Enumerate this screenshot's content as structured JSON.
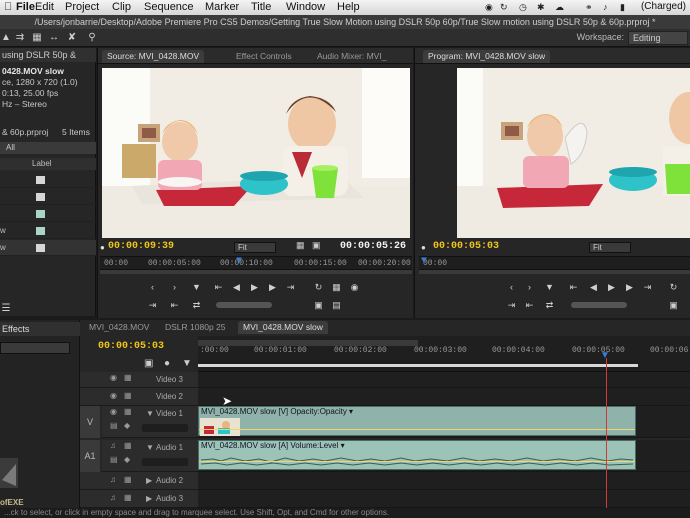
{
  "menubar": {
    "items": [
      "File",
      "Edit",
      "Project",
      "Clip",
      "Sequence",
      "Marker",
      "Title",
      "Window",
      "Help"
    ],
    "battery": "(Charged)"
  },
  "window_title": "/Users/jonbarrie/Desktop/Adobe Premiere Pro CS5 Demos/Getting True Slow Motion using DSLR 50p 60p/True Slow motion using DSLR 50p & 60p.prproj *",
  "workspace": {
    "label": "Workspace:",
    "value": "Editing"
  },
  "project": {
    "tab": "using DSLR 50p &",
    "clip_name": "0428.MOV slow",
    "info": [
      "ce, 1280 x 720 (1.0)",
      "0:13, 25.00 fps",
      "Hz – Stereo"
    ],
    "file": "& 60p.prproj",
    "count": "5 Items",
    "filter": "All",
    "column": "Label",
    "rows": [
      "",
      "",
      "",
      "w",
      "w"
    ],
    "swatch_colors": [
      "#d6d6d6",
      "#d6d6d6",
      "#a9d6c4",
      "#a9d6c4",
      "#d6d6d6"
    ]
  },
  "source": {
    "tabs": [
      "Source: MVI_0428.MOV",
      "Effect Controls",
      "Audio Mixer: MVI_"
    ],
    "tc_current": "00:00:09:39",
    "fit": "Fit",
    "tc_duration": "00:00:05:26",
    "ruler": [
      "00:00",
      "00:00:05:00",
      "00:00:10:00",
      "00:00:15:00",
      "00:00:20:00"
    ]
  },
  "program": {
    "tab": "Program: MVI_0428.MOV slow",
    "tc_current": "00:00:05:03",
    "fit": "Fit",
    "ruler": [
      "00:00"
    ]
  },
  "effects": {
    "tab": "Effects"
  },
  "timeline": {
    "tabs": [
      "MVI_0428.MOV",
      "DSLR 1080p 25",
      "MVI_0428.MOV slow"
    ],
    "tc": "00:00:05:03",
    "ruler": [
      ":00:00",
      "00:00:01:00",
      "00:00:02:00",
      "00:00:03:00",
      "00:00:04:00",
      "00:00:05:00",
      "00:00:06"
    ],
    "tracks": {
      "video3": "Video 3",
      "video2": "Video 2",
      "video1": "Video 1",
      "audio1": "Audio 1",
      "audio2": "Audio 2",
      "audio3": "Audio 3"
    },
    "side_labels": {
      "v": "V",
      "a": "A1"
    },
    "video_clip": "MVI_0428.MOV slow [V]  Opacity:Opacity ▾",
    "audio_clip": "MVI_0428.MOV slow [A]  Volume:Level ▾"
  },
  "status": "...ck to select, or click in empty space and drag to marquee select. Use Shift, Opt, and Cmd for other options.",
  "watermark": "ofEXE",
  "icons": {
    "apple": "apple-icon",
    "wifi": "wifi-icon",
    "volume": "volume-icon",
    "battery": "battery-icon",
    "play": "play-icon"
  },
  "colors": {
    "timecode": "#f0c419",
    "playhead": "#d23a3a",
    "clip_video": "#8fb3aa",
    "clip_audio": "#9cc3b7"
  }
}
